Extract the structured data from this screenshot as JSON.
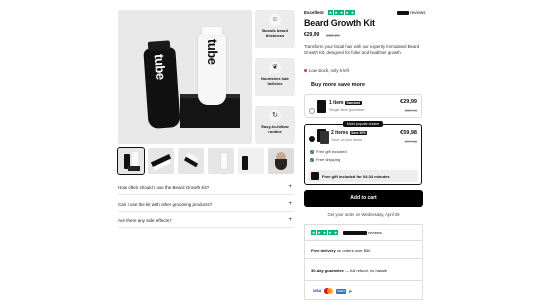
{
  "gallery": {
    "features": [
      {
        "label": "Boosts beard thickness",
        "icon": "beard-icon"
      },
      {
        "label": "Nourishes hair follicles",
        "icon": "leaf-icon"
      },
      {
        "label": "Easy-to-follow routine",
        "icon": "routine-icon"
      }
    ],
    "tube_text": "tube"
  },
  "faqs": [
    {
      "question": "How often should I use the Beard Growth Kit?",
      "icon": "+"
    },
    {
      "question": "Can I use the kit with other grooming products?",
      "icon": "+"
    },
    {
      "question": "Are there any side effects?",
      "icon": "+"
    }
  ],
  "product": {
    "rating_label": "Excellent",
    "reviews_label": "reviews",
    "title": "Beard Growth Kit",
    "price": "€29,99",
    "compare_price": "€39,99",
    "description": "Transform your facial hair with our expertly formulated Beard Growth Kit, designed for fuller and healthier growth.",
    "stock": "Low stock, only 6 left",
    "buy_more": "Buy more save more"
  },
  "bundles": [
    {
      "title": "1 item",
      "badge": "Standard",
      "subtitle": "Single item purchase",
      "price": "€29,99",
      "compare": "€39,99"
    },
    {
      "title": "2 items",
      "badge": "Save 50%",
      "subtitle": "Save on two items",
      "price": "€59,98",
      "compare": "€79,98",
      "ribbon": "Most popular choice",
      "perks": [
        "Free gift included",
        "Free shipping"
      ],
      "gift_bar": "Free gift included for 04:34 minutes"
    }
  ],
  "cart": {
    "button": "Add to cart",
    "delivery_note": "Get your order on Wednesday, April 29"
  },
  "trust": {
    "reviews_label": "reviews",
    "rows": [
      {
        "strong": "Free delivery",
        "rest": "on orders over $50"
      },
      {
        "strong": "30-day guarantee",
        "rest": "— full refund, no hassle"
      }
    ],
    "payments": [
      "VISA",
      "mastercard-icon",
      "AMEX",
      "P"
    ]
  },
  "colors": {
    "trustpilot": "#00b67a",
    "button": "#000000",
    "check": "#3f7a4e",
    "stock": "#d63a3a"
  }
}
